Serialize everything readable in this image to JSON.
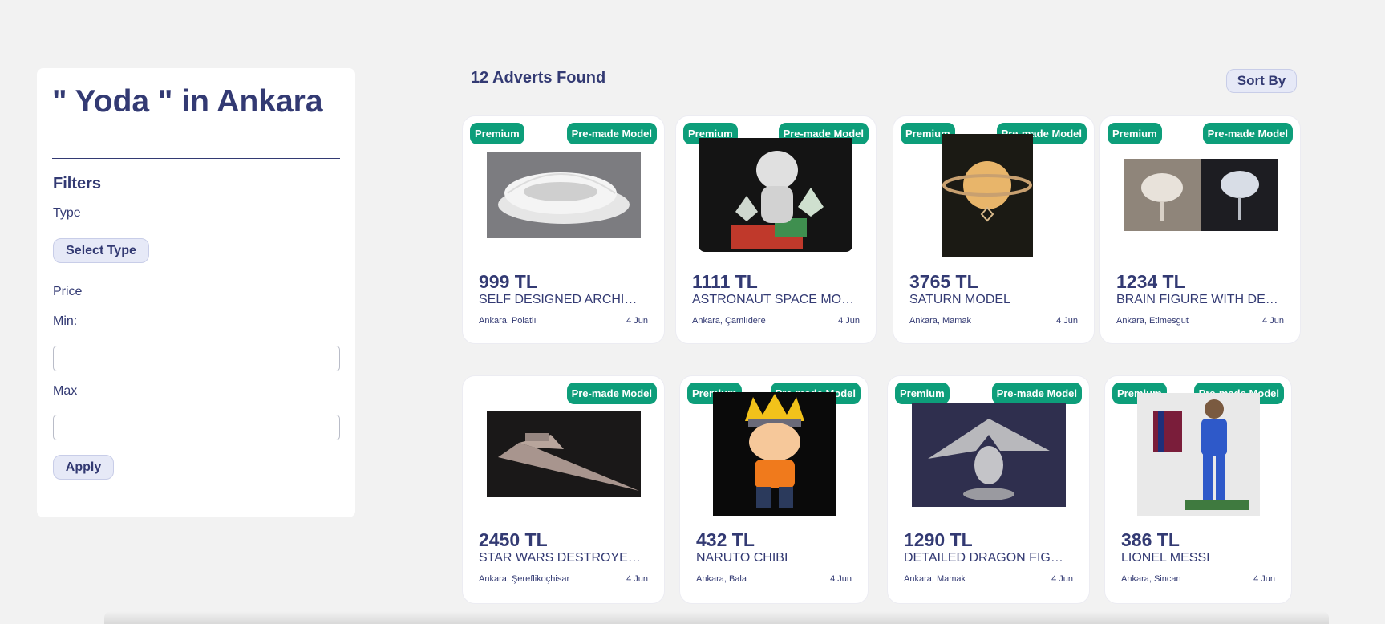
{
  "sidebar": {
    "title": "\" Yoda \" in Ankara",
    "filters_heading": "Filters",
    "type_label": "Type",
    "select_type_label": "Select Type",
    "price_label": "Price",
    "min_label": "Min:",
    "max_label": "Max",
    "min_value": "",
    "max_value": "",
    "apply_label": "Apply"
  },
  "results": {
    "count_text": "12 Adverts Found",
    "sort_label": "Sort By"
  },
  "colors": {
    "accent_navy": "#333a73",
    "badge_green": "#0d9e7a",
    "background": "#f2f2f2"
  },
  "adverts": [
    {
      "premium": "Premium",
      "badge": "Pre-made Model",
      "price": "999 TL",
      "title": "SELF DESIGNED ARCHITECTURE MODEL",
      "location": "Ankara, Polatlı",
      "date": "4 Jun",
      "image": "stadium-model"
    },
    {
      "premium": "Premium",
      "badge": "Pre-made Model",
      "price": "1111 TL",
      "title": "ASTRONAUT SPACE MODEL",
      "location": "Ankara, Çamlıdere",
      "date": "4 Jun",
      "image": "astronaut-figure"
    },
    {
      "premium": "Premium",
      "badge": "Pre-made Model",
      "price": "3765 TL",
      "title": "SATURN MODEL",
      "location": "Ankara, Mamak",
      "date": "4 Jun",
      "image": "saturn-lamp"
    },
    {
      "premium": "Premium",
      "badge": "Pre-made Model",
      "price": "1234 TL",
      "title": "BRAIN FIGURE WITH DESK STAND",
      "location": "Ankara, Etimesgut",
      "date": "4 Jun",
      "image": "brain-figure"
    },
    {
      "premium": "",
      "badge": "Pre-made Model",
      "price": "2450 TL",
      "title": "STAR WARS DESTROYER MODEL",
      "location": "Ankara, Şereflikoçhisar",
      "date": "4 Jun",
      "image": "star-destroyer"
    },
    {
      "premium": "Premium",
      "badge": "Pre-made Model",
      "price": "432 TL",
      "title": "NARUTO CHIBI",
      "location": "Ankara, Bala",
      "date": "4 Jun",
      "image": "naruto-chibi"
    },
    {
      "premium": "Premium",
      "badge": "Pre-made Model",
      "price": "1290 TL",
      "title": "DETAILED DRAGON FIGURE",
      "location": "Ankara, Mamak",
      "date": "4 Jun",
      "image": "dragon-figure"
    },
    {
      "premium": "Premium",
      "badge": "Pre-made Model",
      "price": "386 TL",
      "title": "LIONEL MESSI",
      "location": "Ankara, Sincan",
      "date": "4 Jun",
      "image": "messi-figure"
    }
  ]
}
